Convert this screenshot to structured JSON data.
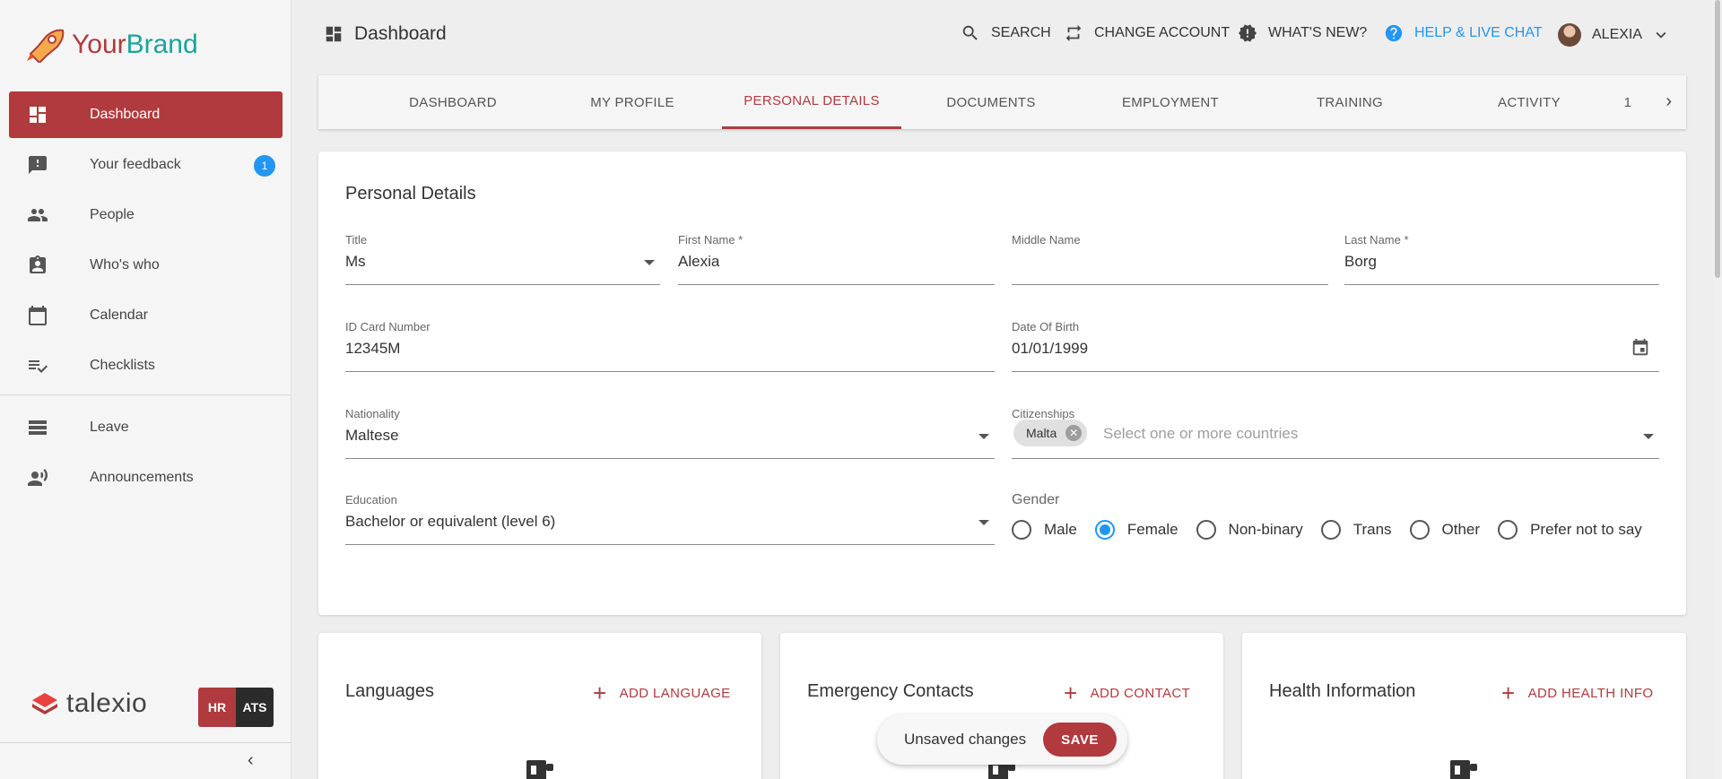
{
  "brand": {
    "name_part1": "Your",
    "name_part2": "Brand"
  },
  "sidebar": {
    "items": [
      {
        "label": "Dashboard",
        "icon": "dashboard-icon",
        "active": true
      },
      {
        "label": "Your feedback",
        "icon": "feedback-icon",
        "badge": "1"
      },
      {
        "label": "People",
        "icon": "people-icon"
      },
      {
        "label": "Who's who",
        "icon": "contact-card-icon"
      },
      {
        "label": "Calendar",
        "icon": "calendar-icon"
      },
      {
        "label": "Checklists",
        "icon": "checklist-icon"
      },
      {
        "label": "Leave",
        "icon": "leave-icon"
      },
      {
        "label": "Announcements",
        "icon": "announcement-icon"
      }
    ],
    "footer": {
      "logo_text": "talexio",
      "switch_hr": "HR",
      "switch_ats": "ATS"
    }
  },
  "header": {
    "title": "Dashboard",
    "search": "SEARCH",
    "change_account": "CHANGE ACCOUNT",
    "whats_new": "WHAT'S NEW?",
    "help": "HELP & LIVE CHAT",
    "user": "ALEXIA"
  },
  "tabs": [
    "DASHBOARD",
    "MY PROFILE",
    "PERSONAL DETAILS",
    "DOCUMENTS",
    "EMPLOYMENT",
    "TRAINING",
    "ACTIVITY",
    "1"
  ],
  "personal": {
    "title": "Personal Details",
    "title_label": "Title",
    "title_value": "Ms",
    "first_name_label": "First Name *",
    "first_name": "Alexia",
    "middle_name_label": "Middle Name",
    "middle_name": "",
    "last_name_label": "Last Name *",
    "last_name": "Borg",
    "id_label": "ID Card Number",
    "id_value": "12345M",
    "dob_label": "Date Of Birth",
    "dob_value": "01/01/1999",
    "nationality_label": "Nationality",
    "nationality": "Maltese",
    "citizenships_label": "Citizenships",
    "citizenship_chip": "Malta",
    "citizenships_placeholder": "Select one or more countries",
    "education_label": "Education",
    "education": "Bachelor or equivalent (level 6)",
    "gender_label": "Gender",
    "gender_options": [
      "Male",
      "Female",
      "Non-binary",
      "Trans",
      "Other",
      "Prefer not to say"
    ],
    "gender_selected": "Female"
  },
  "languages": {
    "title": "Languages",
    "add": "ADD LANGUAGE"
  },
  "emergency": {
    "title": "Emergency Contacts",
    "add": "ADD CONTACT"
  },
  "health": {
    "title": "Health Information",
    "add": "ADD HEALTH INFO"
  },
  "unsaved": {
    "text": "Unsaved changes",
    "save": "SAVE"
  },
  "colors": {
    "accent": "#b03a3e",
    "brand_teal": "#1ba39c",
    "link_blue": "#2196f3"
  }
}
